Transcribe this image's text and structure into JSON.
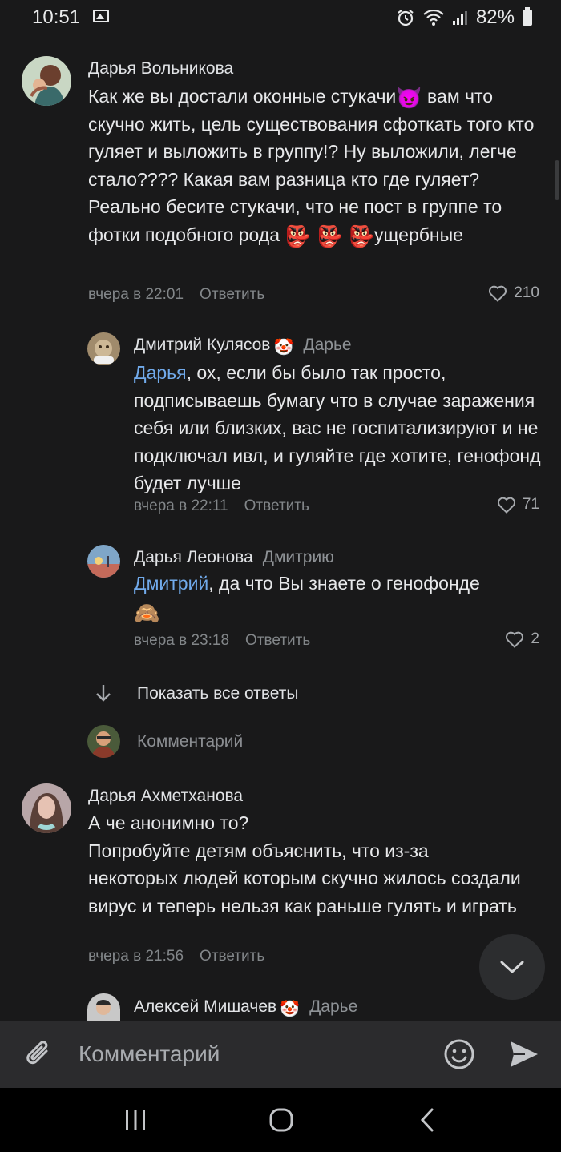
{
  "status_bar": {
    "time": "10:51",
    "battery": "82%",
    "icons": [
      "gallery-icon",
      "alarm-icon",
      "wifi-icon",
      "signal-icon",
      "battery-icon"
    ]
  },
  "comments": [
    {
      "author": "Дарья Вольникова",
      "text_parts": [
        "Как же вы достали оконные стукачи",
        "😈",
        " вам что скучно жить, цель существования сфоткать того кто гуляет и выложить в группу!? Ну выложили, легче стало???? Какая вам разница кто где гуляет? Реально бесите стукачи, что не пост в группе то фотки подобного рода ",
        "👺 👺 👺",
        "ущербные"
      ],
      "time": "вчера в 22:01",
      "reply_label": "Ответить",
      "likes": "210"
    },
    {
      "author": "Дмитрий Кулясов",
      "author_emoji": "🤡",
      "reply_to": "Дарье",
      "mention": "Дарья",
      "text": ", ох, если бы было так просто, подписываешь бумагу что в случае заражения себя или близких, вас не госпитализируют и не подключал ивл, и гуляйте где хотите, генофонд будет лучше",
      "time": "вчера в 22:11",
      "reply_label": "Ответить",
      "likes": "71"
    },
    {
      "author": "Дарья Леонова",
      "reply_to": "Дмитрию",
      "mention": "Дмитрий",
      "text": ", да что Вы знаете о генофонде",
      "text_emoji": "🙈",
      "time": "вчера в 23:18",
      "reply_label": "Ответить",
      "likes": "2"
    },
    {
      "author": "Дарья Ахметханова",
      "text_lines": [
        "А че анонимно то?",
        "Попробуйте детям объяснить, что из-за некоторых людей которым скучно жилось создали вирус и теперь нельзя как раньше гулять и играть"
      ],
      "time": "вчера в 21:56",
      "reply_label": "Ответить"
    },
    {
      "author": "Алексей Мишачев",
      "author_emoji": "🤡",
      "reply_to": "Дарье"
    }
  ],
  "show_all_replies": "Показать все ответы",
  "reply_placeholder": "Комментарий",
  "compose": {
    "placeholder": "Комментарий"
  },
  "colors": {
    "background": "#19191a",
    "link": "#71aaeb",
    "secondary_text": "#828689"
  }
}
